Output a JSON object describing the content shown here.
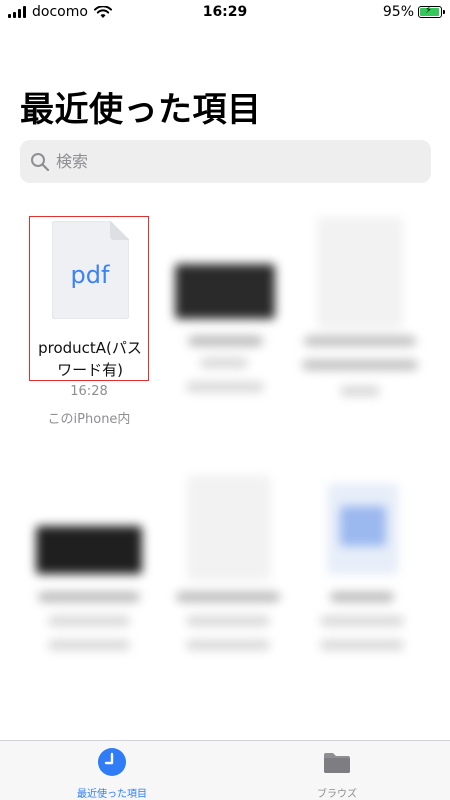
{
  "status_bar": {
    "carrier": "docomo",
    "time": "16:29",
    "battery_percent": "95%",
    "battery_level": 0.95
  },
  "page": {
    "title": "最近使った項目"
  },
  "search": {
    "placeholder": "検索"
  },
  "files": [
    {
      "thumbnail_text": "pdf",
      "name_line1": "productA(パス",
      "name_line2": "ワード有)",
      "time": "16:28",
      "location": "このiPhone内",
      "selected": true
    }
  ],
  "tab_bar": {
    "tabs": [
      {
        "label": "最近使った項目",
        "icon": "clock-icon",
        "active": true
      },
      {
        "label": "ブラウズ",
        "icon": "folder-icon",
        "active": false
      }
    ]
  },
  "colors": {
    "accent": "#2f7cf6",
    "selection_border": "#e03030",
    "pdf_text": "#3b82f6",
    "secondary_text": "#8e8e93"
  }
}
